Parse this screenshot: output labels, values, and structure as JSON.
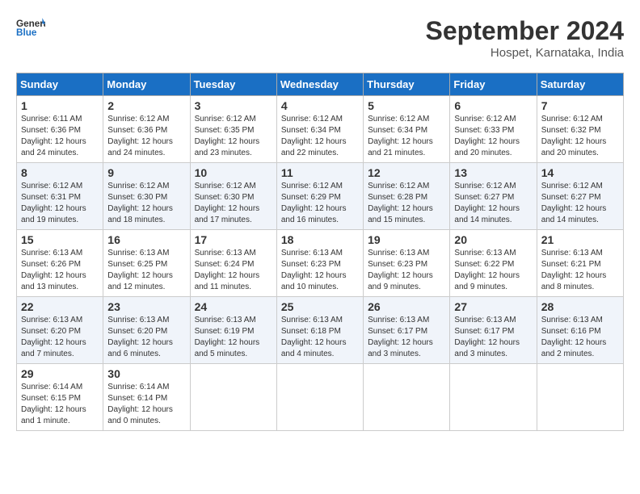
{
  "header": {
    "logo_general": "General",
    "logo_blue": "Blue",
    "month_title": "September 2024",
    "location": "Hospet, Karnataka, India"
  },
  "days_of_week": [
    "Sunday",
    "Monday",
    "Tuesday",
    "Wednesday",
    "Thursday",
    "Friday",
    "Saturday"
  ],
  "weeks": [
    [
      {
        "day": 1,
        "sunrise": "6:11 AM",
        "sunset": "6:36 PM",
        "daylight": "12 hours and 24 minutes."
      },
      {
        "day": 2,
        "sunrise": "6:12 AM",
        "sunset": "6:36 PM",
        "daylight": "12 hours and 24 minutes."
      },
      {
        "day": 3,
        "sunrise": "6:12 AM",
        "sunset": "6:35 PM",
        "daylight": "12 hours and 23 minutes."
      },
      {
        "day": 4,
        "sunrise": "6:12 AM",
        "sunset": "6:34 PM",
        "daylight": "12 hours and 22 minutes."
      },
      {
        "day": 5,
        "sunrise": "6:12 AM",
        "sunset": "6:34 PM",
        "daylight": "12 hours and 21 minutes."
      },
      {
        "day": 6,
        "sunrise": "6:12 AM",
        "sunset": "6:33 PM",
        "daylight": "12 hours and 20 minutes."
      },
      {
        "day": 7,
        "sunrise": "6:12 AM",
        "sunset": "6:32 PM",
        "daylight": "12 hours and 20 minutes."
      }
    ],
    [
      {
        "day": 8,
        "sunrise": "6:12 AM",
        "sunset": "6:31 PM",
        "daylight": "12 hours and 19 minutes."
      },
      {
        "day": 9,
        "sunrise": "6:12 AM",
        "sunset": "6:30 PM",
        "daylight": "12 hours and 18 minutes."
      },
      {
        "day": 10,
        "sunrise": "6:12 AM",
        "sunset": "6:30 PM",
        "daylight": "12 hours and 17 minutes."
      },
      {
        "day": 11,
        "sunrise": "6:12 AM",
        "sunset": "6:29 PM",
        "daylight": "12 hours and 16 minutes."
      },
      {
        "day": 12,
        "sunrise": "6:12 AM",
        "sunset": "6:28 PM",
        "daylight": "12 hours and 15 minutes."
      },
      {
        "day": 13,
        "sunrise": "6:12 AM",
        "sunset": "6:27 PM",
        "daylight": "12 hours and 14 minutes."
      },
      {
        "day": 14,
        "sunrise": "6:12 AM",
        "sunset": "6:27 PM",
        "daylight": "12 hours and 14 minutes."
      }
    ],
    [
      {
        "day": 15,
        "sunrise": "6:13 AM",
        "sunset": "6:26 PM",
        "daylight": "12 hours and 13 minutes."
      },
      {
        "day": 16,
        "sunrise": "6:13 AM",
        "sunset": "6:25 PM",
        "daylight": "12 hours and 12 minutes."
      },
      {
        "day": 17,
        "sunrise": "6:13 AM",
        "sunset": "6:24 PM",
        "daylight": "12 hours and 11 minutes."
      },
      {
        "day": 18,
        "sunrise": "6:13 AM",
        "sunset": "6:23 PM",
        "daylight": "12 hours and 10 minutes."
      },
      {
        "day": 19,
        "sunrise": "6:13 AM",
        "sunset": "6:23 PM",
        "daylight": "12 hours and 9 minutes."
      },
      {
        "day": 20,
        "sunrise": "6:13 AM",
        "sunset": "6:22 PM",
        "daylight": "12 hours and 9 minutes."
      },
      {
        "day": 21,
        "sunrise": "6:13 AM",
        "sunset": "6:21 PM",
        "daylight": "12 hours and 8 minutes."
      }
    ],
    [
      {
        "day": 22,
        "sunrise": "6:13 AM",
        "sunset": "6:20 PM",
        "daylight": "12 hours and 7 minutes."
      },
      {
        "day": 23,
        "sunrise": "6:13 AM",
        "sunset": "6:20 PM",
        "daylight": "12 hours and 6 minutes."
      },
      {
        "day": 24,
        "sunrise": "6:13 AM",
        "sunset": "6:19 PM",
        "daylight": "12 hours and 5 minutes."
      },
      {
        "day": 25,
        "sunrise": "6:13 AM",
        "sunset": "6:18 PM",
        "daylight": "12 hours and 4 minutes."
      },
      {
        "day": 26,
        "sunrise": "6:13 AM",
        "sunset": "6:17 PM",
        "daylight": "12 hours and 3 minutes."
      },
      {
        "day": 27,
        "sunrise": "6:13 AM",
        "sunset": "6:17 PM",
        "daylight": "12 hours and 3 minutes."
      },
      {
        "day": 28,
        "sunrise": "6:13 AM",
        "sunset": "6:16 PM",
        "daylight": "12 hours and 2 minutes."
      }
    ],
    [
      {
        "day": 29,
        "sunrise": "6:14 AM",
        "sunset": "6:15 PM",
        "daylight": "12 hours and 1 minute."
      },
      {
        "day": 30,
        "sunrise": "6:14 AM",
        "sunset": "6:14 PM",
        "daylight": "12 hours and 0 minutes."
      },
      null,
      null,
      null,
      null,
      null
    ]
  ]
}
